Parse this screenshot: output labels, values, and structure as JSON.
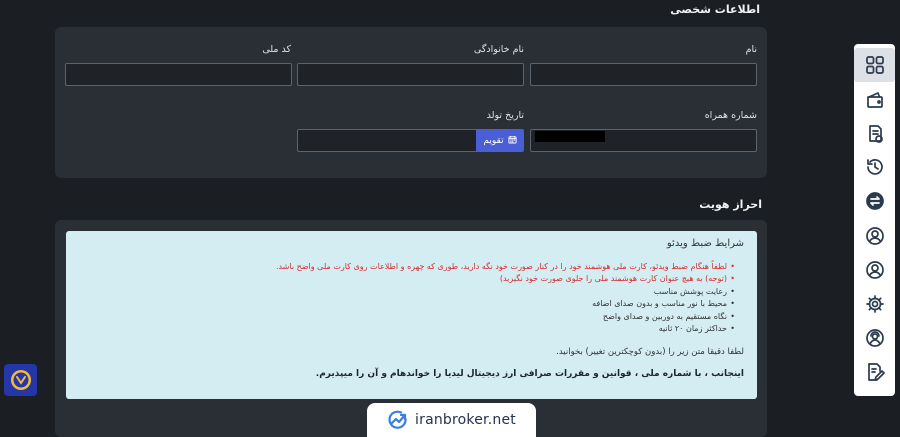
{
  "personal": {
    "title": "اطلاعات شخصی",
    "first_name_label": "نام",
    "last_name_label": "نام خانوادگی",
    "national_code_label": "کد ملی",
    "mobile_label": "شماره همراه",
    "birth_date_label": "تاریخ تولد",
    "calendar_label": "تقویم"
  },
  "identity": {
    "title": "احراز هویت",
    "notice_title": "شرایط ضبط ویدئو",
    "rules": [
      "لطفاً هنگام ضبط ویدئو، کارت ملی هوشمند خود را در کنار صورت خود نگه دارید، طوری که چهره و اطلاعات روی کارت ملی واضح باشد.",
      "(توجه) به هیچ عنوان کارت هوشمند ملی را جلوی صورت خود نگیرید)",
      "رعایت پوشش مناسب",
      "محیط با نور مناسب و بدون صدای اضافه",
      "نگاه مستقیم به دوربین و صدای واضح",
      "حداکثر زمان ۲۰ ثانیه"
    ],
    "read_instruction": "لطفا دقیقا متن زیر را (بدون کوچکترین تغییر) بخوانید.",
    "pledge": "اینجانب ، با شماره ملی ، قوانین و مقررات صرافی ارز دیجیتال لیدیا را خواندهام و آن را میپذیرم."
  },
  "watermark": "iranbroker.net",
  "icons": {
    "rail": [
      "dashboard-icon",
      "wallet-icon",
      "orders-icon",
      "history-icon",
      "exchange-icon",
      "user-icon",
      "user-circle-icon",
      "settings-icon",
      "support-user-icon",
      "edit-document-icon"
    ]
  },
  "colors": {
    "accent": "#4a5ed6",
    "background": "#1b1e23",
    "card": "#2a2f36",
    "notice": "#d4edf3",
    "warning": "#d62d2d"
  }
}
